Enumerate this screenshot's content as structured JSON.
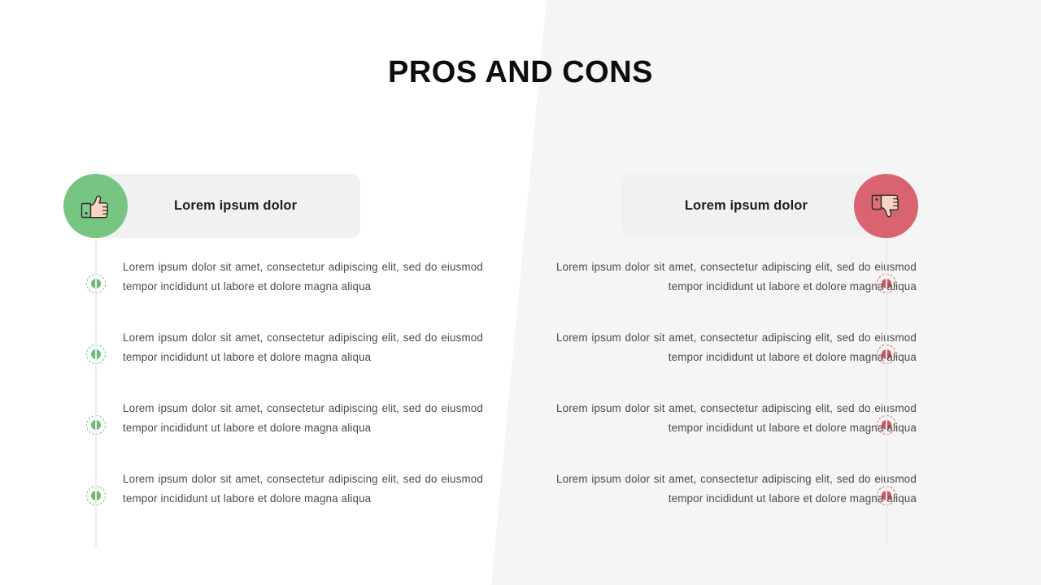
{
  "slide": {
    "title": "PROS AND CONS",
    "background": {
      "left_color": "#ffffff",
      "right_color": "#f5f5f5"
    }
  },
  "columns": [
    {
      "side": "pros",
      "icon": "thumbs-up-icon",
      "accent_color": "#76c583",
      "dot_color": "#67bf74",
      "pill_color": "#f1f1f1",
      "header_label": "Lorem ipsum dolor",
      "items": [
        {
          "text": "Lorem ipsum dolor sit amet, consectetur adipiscing elit, sed do eiusmod tempor incididunt ut labore et dolore magna aliqua"
        },
        {
          "text": "Lorem ipsum dolor sit amet, consectetur adipiscing elit, sed do eiusmod tempor incididunt ut labore et dolore magna aliqua"
        },
        {
          "text": "Lorem ipsum dolor sit amet, consectetur adipiscing elit, sed do eiusmod tempor incididunt ut labore et dolore magna aliqua"
        },
        {
          "text": "Lorem ipsum dolor sit amet, consectetur adipiscing elit, sed do eiusmod tempor incididunt ut labore et dolore magna aliqua"
        }
      ]
    },
    {
      "side": "cons",
      "icon": "thumbs-down-icon",
      "accent_color": "#d9636f",
      "dot_color": "#d2555f",
      "pill_color": "#f1f1f1",
      "header_label": "Lorem ipsum dolor",
      "items": [
        {
          "text": "Lorem ipsum dolor sit amet, consectetur adipiscing elit, sed do eiusmod tempor incididunt ut labore et dolore magna aliqua"
        },
        {
          "text": "Lorem ipsum dolor sit amet, consectetur adipiscing elit, sed do eiusmod tempor incididunt ut labore et dolore magna aliqua"
        },
        {
          "text": "Lorem ipsum dolor sit amet, consectetur adipiscing elit, sed do eiusmod tempor incididunt ut labore et dolore magna aliqua"
        },
        {
          "text": "Lorem ipsum dolor sit amet, consectetur adipiscing elit, sed do eiusmod tempor incididunt ut labore et dolore magna aliqua"
        }
      ]
    }
  ]
}
